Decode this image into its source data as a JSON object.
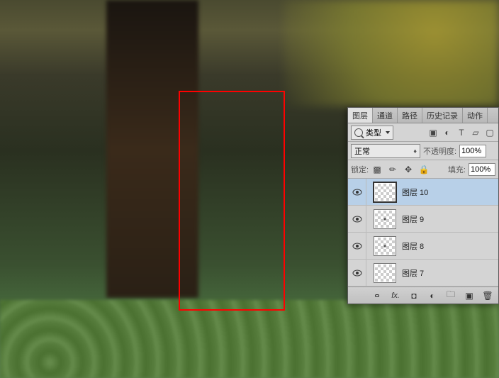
{
  "tabs": {
    "layers": "图层",
    "channels": "通道",
    "paths": "路径",
    "history": "历史记录",
    "actions": "动作"
  },
  "filter": {
    "label": "类型"
  },
  "blend": {
    "mode": "正常",
    "opacity_label": "不透明度:",
    "opacity": "100%"
  },
  "lock": {
    "label": "锁定:",
    "fill_label": "填充:",
    "fill": "100%"
  },
  "layers": [
    {
      "name": "图层 10",
      "active": true,
      "dot": false
    },
    {
      "name": "图层 9",
      "active": false,
      "dot": true
    },
    {
      "name": "图层 8",
      "active": false,
      "dot": true
    },
    {
      "name": "图层 7",
      "active": false,
      "dot": false
    }
  ],
  "footer": {
    "fx": "fx."
  }
}
